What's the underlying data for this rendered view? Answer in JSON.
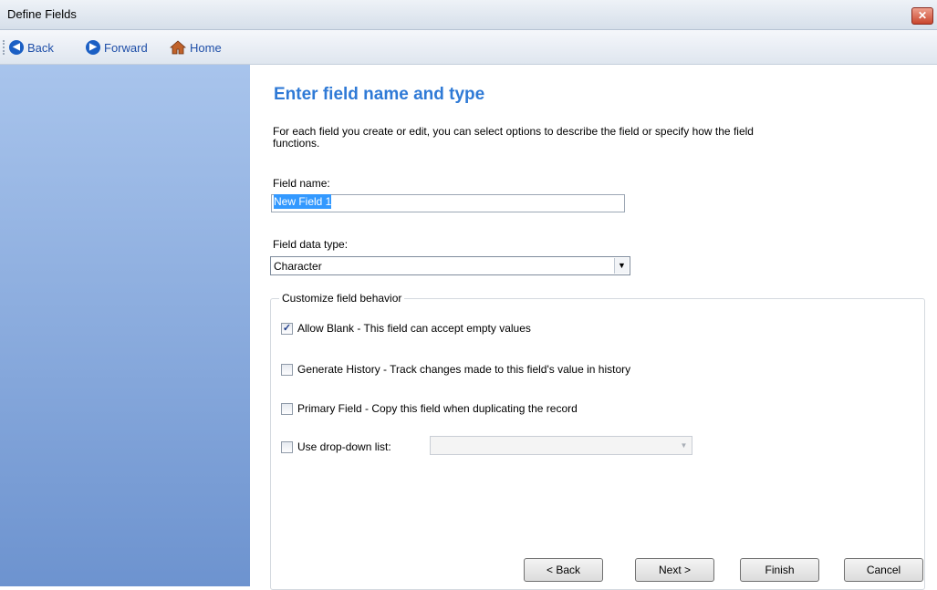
{
  "window": {
    "title": "Define Fields",
    "close_symbol": "✕"
  },
  "toolbar": {
    "back_label": "Back",
    "forward_label": "Forward",
    "home_label": "Home"
  },
  "main": {
    "heading": "Enter field name and type",
    "description": "For each field you create or edit, you can select options to describe the field or specify how the field functions.",
    "field_name_label": "Field name:",
    "field_name_value": "New Field 1",
    "data_type_label": "Field data type:",
    "data_type_value": "Character",
    "group_label": "Customize field behavior",
    "options": [
      {
        "label": "Allow Blank - This field can accept empty values",
        "checked": true
      },
      {
        "label": "Generate History - Track changes made to this field's value in history",
        "checked": false
      },
      {
        "label": "Primary Field - Copy this field when duplicating the record",
        "checked": false
      },
      {
        "label": "Use drop-down list:",
        "checked": false
      }
    ]
  },
  "footer": {
    "back": "< Back",
    "next": "Next >",
    "finish": "Finish",
    "cancel": "Cancel"
  },
  "colors": {
    "heading": "#2f7ad6",
    "sidebar_top": "#a8c4ec",
    "sidebar_bottom": "#6d93cf",
    "selection": "#3399ff"
  },
  "icons": {
    "back": "back-arrow-icon",
    "forward": "forward-arrow-icon",
    "home": "home-icon"
  }
}
